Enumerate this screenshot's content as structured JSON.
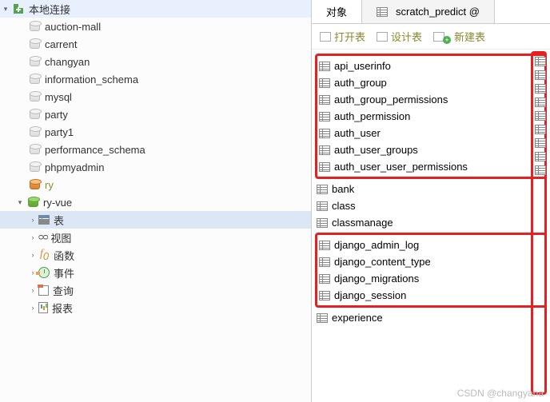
{
  "sidebar": {
    "connection": "本地连接",
    "databases": [
      "auction-mall",
      "carrent",
      "changyan",
      "information_schema",
      "mysql",
      "party",
      "party1",
      "performance_schema",
      "phpmyadmin",
      "ry"
    ],
    "active_db": "ry-vue",
    "nodes": {
      "tables": "表",
      "views": "视图",
      "functions": "函数",
      "events": "事件",
      "queries": "查询",
      "reports": "报表"
    }
  },
  "tabs": {
    "objects": "对象",
    "scratch": "scratch_predict @"
  },
  "toolbar": {
    "open": "打开表",
    "design": "设计表",
    "new": "新建表"
  },
  "tables_group1": [
    "api_userinfo",
    "auth_group",
    "auth_group_permissions",
    "auth_permission",
    "auth_user",
    "auth_user_groups",
    "auth_user_user_permissions"
  ],
  "tables_mid": [
    "bank",
    "class",
    "classmanage"
  ],
  "tables_group2": [
    "django_admin_log",
    "django_content_type",
    "django_migrations",
    "django_session"
  ],
  "tables_after": [
    "experience"
  ],
  "watermark": "CSDN @changyana"
}
